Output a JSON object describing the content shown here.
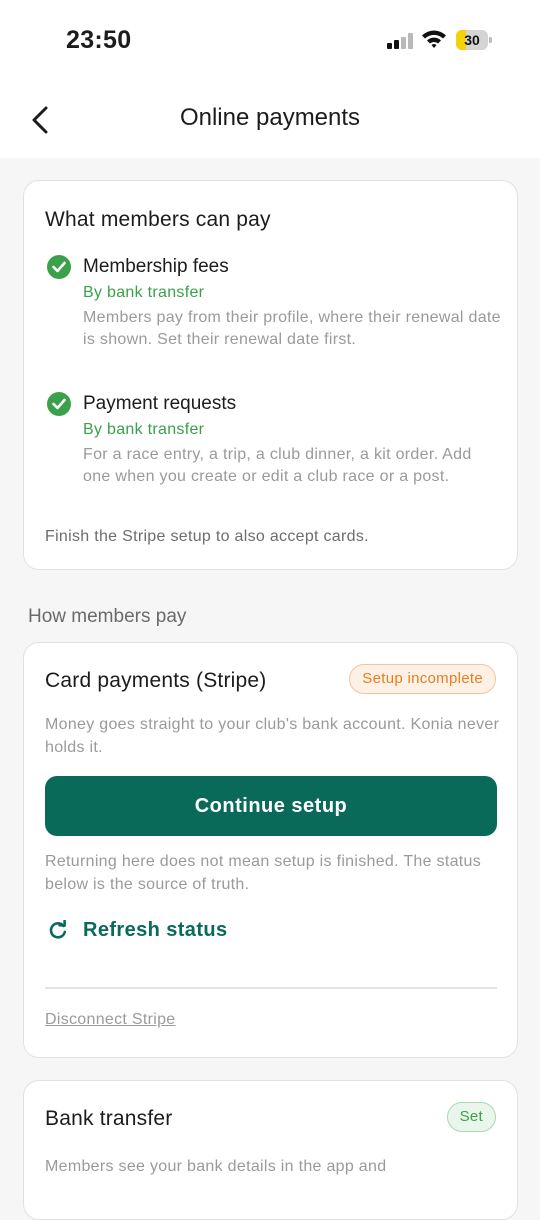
{
  "status_bar": {
    "time": "23:50",
    "battery": "30",
    "battery_level": 0.3
  },
  "header": {
    "title": "Online payments"
  },
  "what_members_can_pay": {
    "heading": "What members can pay",
    "items": [
      {
        "title": "Membership fees",
        "method": "By bank transfer",
        "description": "Members pay from their profile, where their renewal date is shown. Set their renewal date first."
      },
      {
        "title": "Payment requests",
        "method": "By bank transfer",
        "description": "For a race entry, a trip, a club dinner, a kit order. Add one when you create or edit a club race or a post."
      }
    ],
    "note": "Finish the Stripe setup to also accept cards."
  },
  "how_members_pay": {
    "label": "How members pay"
  },
  "stripe": {
    "title": "Card payments (Stripe)",
    "badge": "Setup incomplete",
    "description": "Money goes straight to your club's bank account. Konia never holds it.",
    "continue_label": "Continue setup",
    "returning_note": "Returning here does not mean setup is finished. The status below is the source of truth.",
    "refresh_label": "Refresh status",
    "disconnect_label": "Disconnect Stripe"
  },
  "bank_transfer": {
    "title": "Bank transfer",
    "badge": "Set",
    "description": "Members see your bank details in the app and"
  },
  "colors": {
    "accent": "#0a6a5a",
    "success": "#3aa14a",
    "warning": "#e67e22"
  }
}
